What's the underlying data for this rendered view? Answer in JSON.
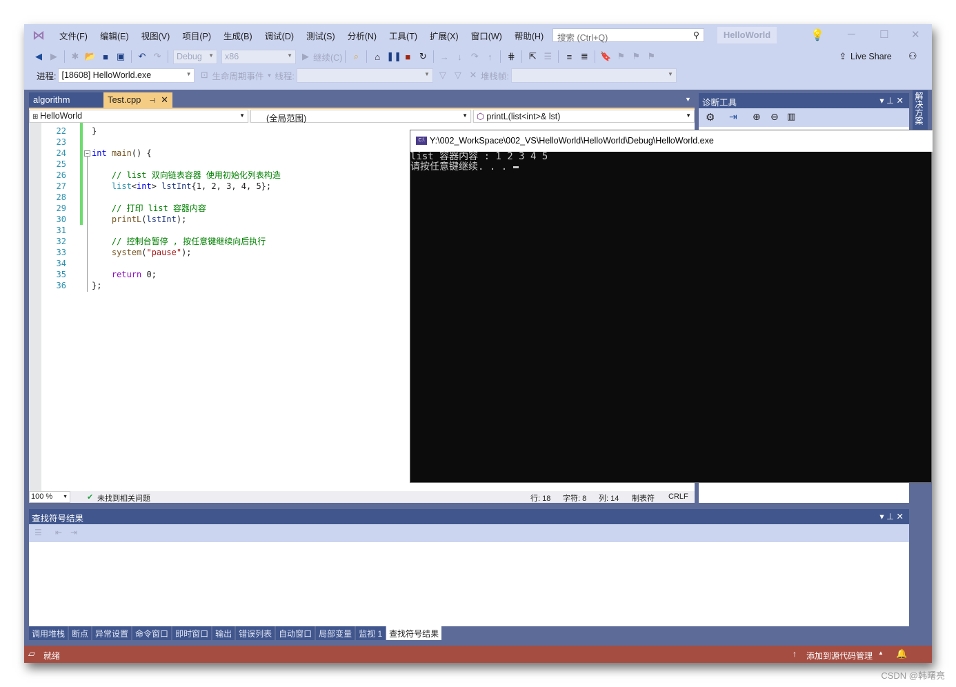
{
  "menu": [
    "文件(F)",
    "编辑(E)",
    "视图(V)",
    "项目(P)",
    "生成(B)",
    "调试(D)",
    "测试(S)",
    "分析(N)",
    "工具(T)",
    "扩展(X)",
    "窗口(W)",
    "帮助(H)"
  ],
  "search": {
    "placeholder": "搜索 (Ctrl+Q)"
  },
  "solution_name": "HelloWorld",
  "toolbar": {
    "config": "Debug",
    "platform": "x86",
    "continue": "继续(C)",
    "live_share": "Live Share"
  },
  "debugbar": {
    "process_label": "进程:",
    "process": "[18608] HelloWorld.exe",
    "lifecycle": "生命周期事件",
    "thread_label": "线程:",
    "stackframe_label": "堆栈帧:"
  },
  "tabs": [
    {
      "label": "algorithm",
      "active": false
    },
    {
      "label": "Test.cpp",
      "active": true
    }
  ],
  "nav": {
    "project": "HelloWorld",
    "scope": "(全局范围)",
    "member": "printL(list<int>& lst)"
  },
  "editor": {
    "line_numbers": [
      "22",
      "23",
      "24",
      "25",
      "26",
      "27",
      "28",
      "29",
      "30",
      "31",
      "32",
      "33",
      "34",
      "35",
      "36"
    ],
    "lines": [
      [
        {
          "t": "}",
          "c": "#1e1e1e"
        }
      ],
      [],
      [
        {
          "t": "int",
          "c": "#0000ff"
        },
        {
          "t": " main",
          "c": "#74531f"
        },
        {
          "t": "() {",
          "c": "#1e1e1e"
        }
      ],
      [],
      [
        {
          "t": "    // list 双向链表容器 使用初始化列表构造",
          "c": "#008000"
        }
      ],
      [
        {
          "t": "    list",
          "c": "#2b91af"
        },
        {
          "t": "<",
          "c": "#1e1e1e"
        },
        {
          "t": "int",
          "c": "#0000ff"
        },
        {
          "t": "> ",
          "c": "#1e1e1e"
        },
        {
          "t": "lstInt",
          "c": "#1f377f"
        },
        {
          "t": "{1, 2, 3, 4, 5};",
          "c": "#1e1e1e"
        }
      ],
      [],
      [
        {
          "t": "    // 打印 list 容器内容",
          "c": "#008000"
        }
      ],
      [
        {
          "t": "    printL",
          "c": "#74531f"
        },
        {
          "t": "(",
          "c": "#1e1e1e"
        },
        {
          "t": "lstInt",
          "c": "#1f377f"
        },
        {
          "t": ");",
          "c": "#1e1e1e"
        }
      ],
      [],
      [
        {
          "t": "    // 控制台暂停 , 按任意键继续向后执行",
          "c": "#008000"
        }
      ],
      [
        {
          "t": "    system",
          "c": "#74531f"
        },
        {
          "t": "(",
          "c": "#1e1e1e"
        },
        {
          "t": "\"pause\"",
          "c": "#a31515"
        },
        {
          "t": ");",
          "c": "#1e1e1e"
        }
      ],
      [],
      [
        {
          "t": "    return",
          "c": "#8f08c4"
        },
        {
          "t": " 0;",
          "c": "#1e1e1e"
        }
      ],
      [
        {
          "t": "};",
          "c": "#1e1e1e"
        }
      ]
    ],
    "zoom": "100 %",
    "issues": "未找到相关问题",
    "row": "行: 18",
    "char": "字符: 8",
    "col": "列: 14",
    "tabs": "制表符",
    "eol": "CRLF"
  },
  "diagnostics": {
    "title": "诊断工具"
  },
  "solution_explorer_tab": "解决方案资源管理器",
  "console": {
    "title": "Y:\\002_WorkSpace\\002_VS\\HelloWorld\\HelloWorld\\Debug\\HelloWorld.exe",
    "icon_text": "C:\\",
    "lines": [
      "list 容器内容 : 1 2 3 4 5",
      "请按任意键继续. . . "
    ]
  },
  "find_symbol": {
    "title": "查找符号结果"
  },
  "bottom_tabs": [
    "调用堆栈",
    "断点",
    "异常设置",
    "命令窗口",
    "即时窗口",
    "输出",
    "错误列表",
    "自动窗口",
    "局部变量",
    "监视 1",
    "查找符号结果"
  ],
  "status": {
    "ready": "就绪",
    "source_control": "添加到源代码管理"
  },
  "watermark": "CSDN @韩曙亮",
  "colors": {
    "accent": "#40568d",
    "status_bar": "#a64d42",
    "active_tab": "#f5cc84"
  }
}
